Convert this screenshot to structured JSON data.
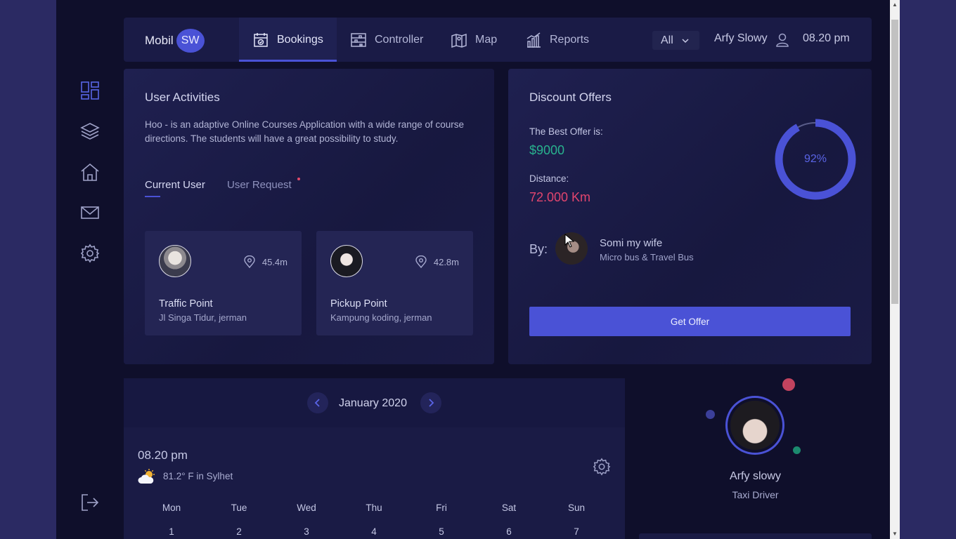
{
  "brand": {
    "text": "Mobil",
    "badge": "SW"
  },
  "nav": {
    "tabs": [
      {
        "label": "Bookings",
        "icon": "calendar-check-icon",
        "active": true
      },
      {
        "label": "Controller",
        "icon": "sliders-icon",
        "active": false
      },
      {
        "label": "Map",
        "icon": "map-icon",
        "active": false
      },
      {
        "label": "Reports",
        "icon": "bar-chart-icon",
        "active": false
      }
    ],
    "filter": "All",
    "user": "Arfy Slowy",
    "time": "08.20 pm"
  },
  "sidebar": {
    "icons": [
      "dashboard-icon",
      "layers-icon",
      "home-icon",
      "mail-icon",
      "settings-icon",
      "logout-icon"
    ]
  },
  "user_activities": {
    "title": "User Activities",
    "description": "Hoo - is an adaptive Online Courses Application with a wide range of course directions. The students will have a great possibility to study.",
    "tabs": [
      "Current User",
      "User Request"
    ],
    "points": [
      {
        "distance": "45.4m",
        "name": "Traffic Point",
        "address": "Jl Singa Tidur, jerman"
      },
      {
        "distance": "42.8m",
        "name": "Pickup Point",
        "address": "Kampung koding, jerman"
      }
    ]
  },
  "discount": {
    "title": "Discount Offers",
    "best_offer_label": "The Best Offer is:",
    "best_offer": "$9000",
    "distance_label": "Distance:",
    "distance": "72.000 Km",
    "percent_text": "92%",
    "percent_value": 92,
    "by_label": "By:",
    "by_name": "Somi my wife",
    "by_sub": "Micro bus & Travel Bus",
    "button": "Get Offer"
  },
  "calendar": {
    "month": "January 2020",
    "time": "08.20 pm",
    "weather": "81.2° F in Sylhet",
    "days": [
      "Mon",
      "Tue",
      "Wed",
      "Thu",
      "Fri",
      "Sat",
      "Sun"
    ],
    "first_row": [
      "1",
      "2",
      "3",
      "4",
      "5",
      "6",
      "7"
    ]
  },
  "profile": {
    "name": "Arfy slowy",
    "role": "Taxi Driver"
  },
  "colors": {
    "accent": "#4a52d6",
    "green": "#28b28e",
    "red": "#e2456e",
    "bubble_red": "#c2435f",
    "bubble_blue": "#3b3f9a",
    "bubble_green": "#1c8a6e"
  }
}
